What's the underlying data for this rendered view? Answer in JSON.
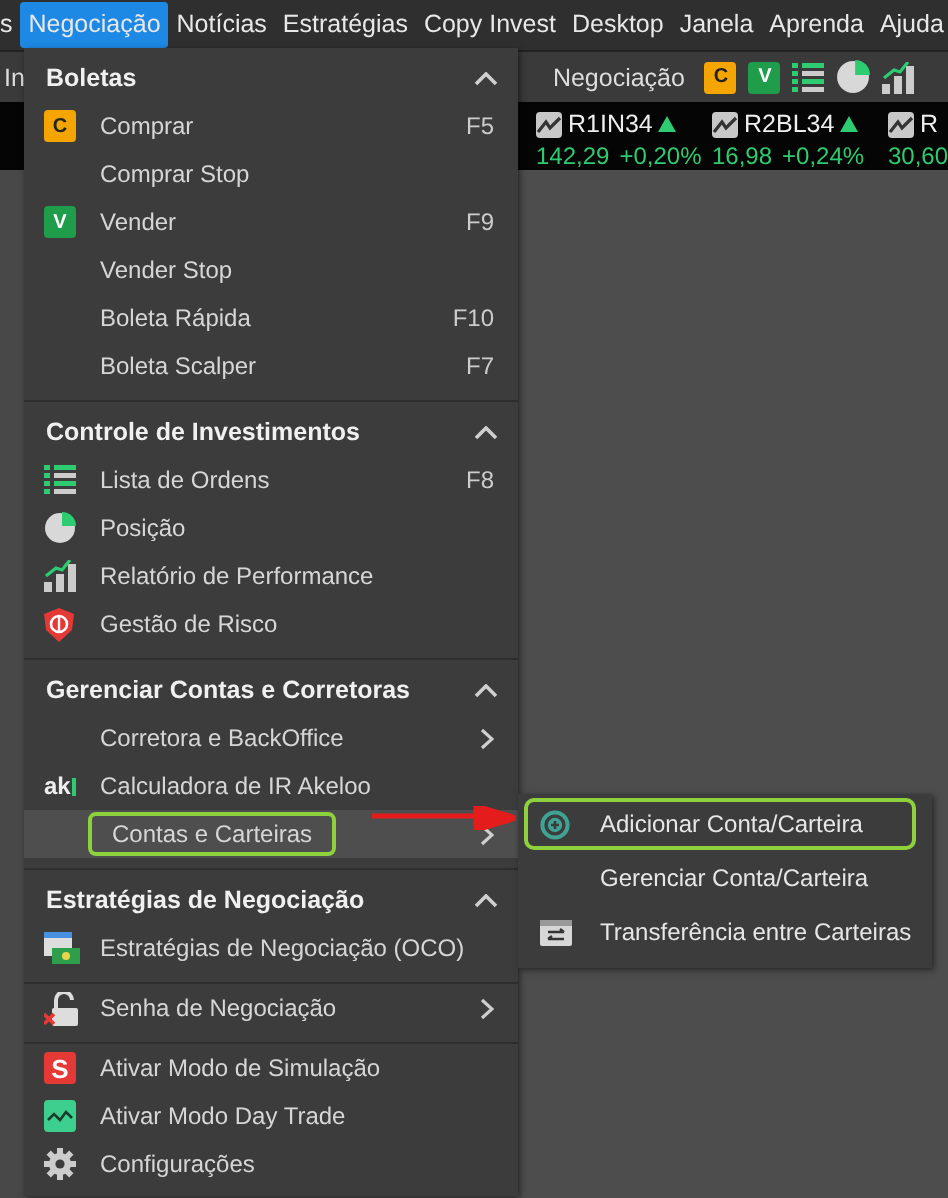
{
  "menubar": [
    {
      "label": "s",
      "selected": false
    },
    {
      "label": "Negociação",
      "selected": true
    },
    {
      "label": "Notícias",
      "selected": false
    },
    {
      "label": "Estratégias",
      "selected": false
    },
    {
      "label": "Copy Invest",
      "selected": false
    },
    {
      "label": "Desktop",
      "selected": false
    },
    {
      "label": "Janela",
      "selected": false
    },
    {
      "label": "Aprenda",
      "selected": false
    },
    {
      "label": "Ajuda",
      "selected": false
    }
  ],
  "toolbar": {
    "left_label": "In",
    "label": "Negociação",
    "buy_badge": "C",
    "sell_badge": "V"
  },
  "tickers": [
    {
      "symbol": "R1IN34",
      "price": "142,29",
      "change": "+0,20%"
    },
    {
      "symbol": "R2BL34",
      "price": "16,98",
      "change": "+0,24%"
    },
    {
      "symbol": "R",
      "price": "30,60"
    }
  ],
  "menu": {
    "sections": [
      {
        "title": "Boletas",
        "expanded": true,
        "items": [
          {
            "label": "Comprar",
            "shortcut": "F5",
            "kind": "buy",
            "badge": "C",
            "selected": false,
            "submenu": false,
            "callout": false
          },
          {
            "label": "Comprar Stop",
            "selected": false,
            "submenu": false,
            "callout": false
          },
          {
            "label": "Vender",
            "shortcut": "F9",
            "kind": "sell",
            "badge": "V",
            "selected": false,
            "submenu": false,
            "callout": false
          },
          {
            "label": "Vender Stop",
            "selected": false,
            "submenu": false,
            "callout": false
          },
          {
            "label": "Boleta Rápida",
            "shortcut": "F10",
            "selected": false,
            "submenu": false,
            "callout": false
          },
          {
            "label": "Boleta Scalper",
            "shortcut": "F7",
            "selected": false,
            "submenu": false,
            "callout": false
          }
        ]
      },
      {
        "title": "Controle de Investimentos",
        "expanded": true,
        "items": [
          {
            "label": "Lista de Ordens",
            "shortcut": "F8",
            "kind": "list",
            "selected": false,
            "submenu": false,
            "callout": false
          },
          {
            "label": "Posição",
            "kind": "pie",
            "selected": false,
            "submenu": false,
            "callout": false
          },
          {
            "label": "Relatório de Performance",
            "kind": "bars",
            "selected": false,
            "submenu": false,
            "callout": false
          },
          {
            "label": "Gestão de Risco",
            "kind": "shield",
            "selected": false,
            "submenu": false,
            "callout": false
          }
        ]
      },
      {
        "title": "Gerenciar Contas e Corretoras",
        "expanded": true,
        "items": [
          {
            "label": "Corretora e BackOffice",
            "selected": false,
            "submenu": true,
            "callout": false
          },
          {
            "label": "Calculadora de IR Akeloo",
            "kind": "logo",
            "logo": "ak",
            "selected": false,
            "submenu": false,
            "callout": false
          },
          {
            "label": "Contas e Carteiras",
            "selected": true,
            "submenu": true,
            "callout": true
          }
        ]
      },
      {
        "title": "Estratégias de Negociação",
        "expanded": true,
        "items": [
          {
            "label": "Estratégias de Negociação (OCO)",
            "kind": "strategy",
            "selected": false,
            "submenu": false,
            "callout": false
          }
        ]
      },
      {
        "items": [
          {
            "label": "Senha de Negociação",
            "kind": "lock",
            "selected": false,
            "submenu": true,
            "callout": false
          }
        ]
      },
      {
        "items": [
          {
            "label": "Ativar Modo de Simulação",
            "kind": "sim",
            "badge": "S",
            "selected": false,
            "submenu": false,
            "callout": false
          },
          {
            "label": "Ativar Modo Day Trade",
            "kind": "daytrade",
            "selected": false,
            "submenu": false,
            "callout": false
          },
          {
            "label": "Configurações",
            "kind": "gear",
            "selected": false,
            "submenu": false,
            "callout": false
          }
        ]
      }
    ]
  },
  "submenu": {
    "items": [
      {
        "label": "Adicionar Conta/Carteira",
        "kind": "add",
        "callout": true
      },
      {
        "label": "Gerenciar Conta/Carteira",
        "callout": false
      },
      {
        "label": "Transferência entre Carteiras",
        "kind": "transfer",
        "callout": false
      }
    ]
  }
}
